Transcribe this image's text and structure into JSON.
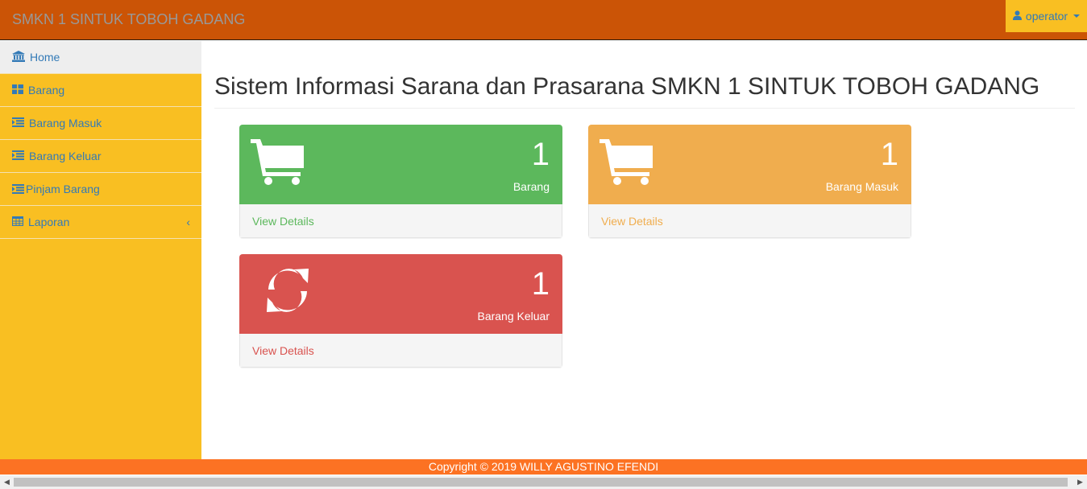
{
  "navbar": {
    "brand": "SMKN 1 SINTUK TOBOH GADANG",
    "user_label": "operator",
    "user_icon": "user-icon"
  },
  "sidebar": {
    "items": [
      {
        "label": "Home",
        "icon": "bank-icon",
        "active": true
      },
      {
        "label": "Barang",
        "icon": "dashboard-grid-icon"
      },
      {
        "label": "Barang Masuk",
        "icon": "indent-list-icon"
      },
      {
        "label": "Barang Keluar",
        "icon": "indent-list-icon"
      },
      {
        "label": "Pinjam Barang",
        "icon": "indent-list-icon"
      },
      {
        "label": "Laporan",
        "icon": "table-icon",
        "chevron": "‹"
      }
    ]
  },
  "page": {
    "title": "Sistem Informasi Sarana dan Prasarana SMKN 1 SINTUK TOBOH GADANG"
  },
  "panels": [
    {
      "count": "1",
      "label": "Barang",
      "link": "View Details",
      "icon": "shopping-cart-icon",
      "color": "#5cb85c"
    },
    {
      "count": "1",
      "label": "Barang Masuk",
      "link": "View Details",
      "icon": "shopping-cart-icon",
      "color": "#f0ad4e"
    },
    {
      "count": "1",
      "label": "Barang Keluar",
      "link": "View Details",
      "icon": "refresh-icon",
      "color": "#d9534f"
    }
  ],
  "footer": {
    "text": "Copyright © 2019 WILLY AGUSTINO EFENDI"
  },
  "colors": {
    "navbar": "#cb5406",
    "sidebar": "#f9bf22",
    "footer": "#fc7223",
    "link": "#337ab7"
  }
}
